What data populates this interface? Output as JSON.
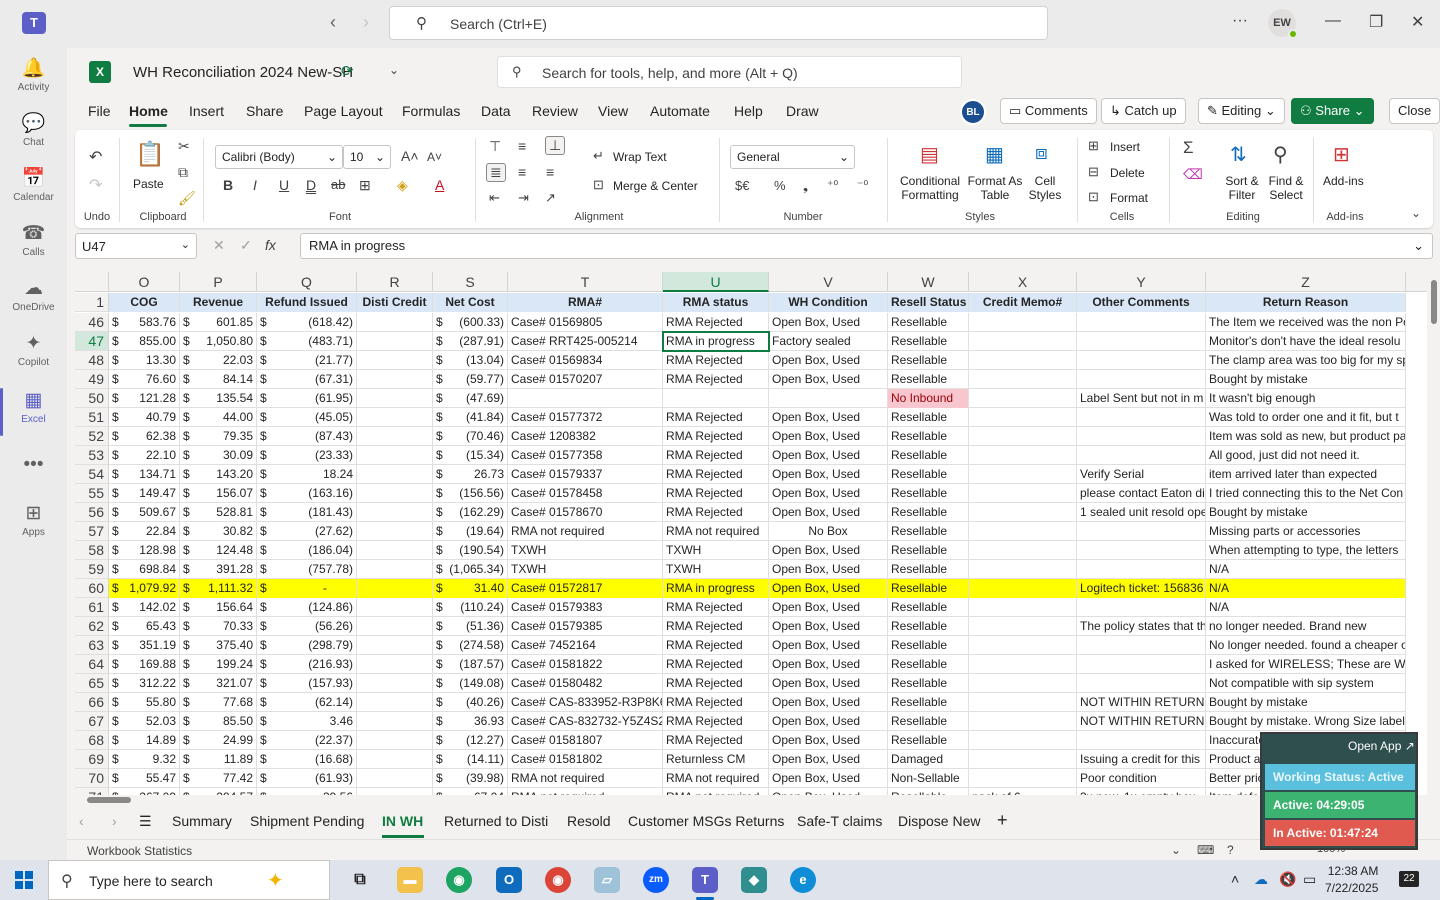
{
  "teams": {
    "search_placeholder": "Search (Ctrl+E)",
    "avatar": "EW",
    "rail": [
      {
        "label": "Activity",
        "icon": "bell-icon",
        "glyph": "🔔"
      },
      {
        "label": "Chat",
        "icon": "chat-icon",
        "glyph": "💬"
      },
      {
        "label": "Calendar",
        "icon": "calendar-icon",
        "glyph": "📅"
      },
      {
        "label": "Calls",
        "icon": "phone-icon",
        "glyph": "☎"
      },
      {
        "label": "OneDrive",
        "icon": "cloud-icon",
        "glyph": "☁"
      },
      {
        "label": "Copilot",
        "icon": "copilot-icon",
        "glyph": "✦"
      },
      {
        "label": "Excel",
        "icon": "excel-icon",
        "glyph": "▦"
      },
      {
        "label": "",
        "icon": "more-icon",
        "glyph": "•••"
      },
      {
        "label": "Apps",
        "icon": "apps-icon",
        "glyph": "⊞"
      }
    ]
  },
  "excel": {
    "title": "WH Reconciliation 2024 New-SH",
    "search_placeholder": "Search for tools, help, and more (Alt + Q)",
    "menus": [
      "File",
      "Home",
      "Insert",
      "Share",
      "Page Layout",
      "Formulas",
      "Data",
      "Review",
      "View",
      "Automate",
      "Help",
      "Draw"
    ],
    "user_badge": "BL",
    "buttons": {
      "comments": "Comments",
      "catchup": "Catch up",
      "editing": "Editing",
      "share": "Share",
      "close": "Close"
    },
    "ribbon": {
      "undo": "Undo",
      "paste": "Paste",
      "clipboard": "Clipboard",
      "font_name": "Calibri (Body)",
      "font_size": "10",
      "font": "Font",
      "wrap_text": "Wrap Text",
      "merge_center": "Merge & Center",
      "alignment": "Alignment",
      "number_format": "General",
      "number": "Number",
      "conditional_1": "Conditional",
      "conditional_2": "Formatting",
      "format_table_1": "Format As",
      "format_table_2": "Table",
      "cell_styles_1": "Cell",
      "cell_styles_2": "Styles",
      "styles": "Styles",
      "insert": "Insert",
      "delete": "Delete",
      "format": "Format",
      "cells": "Cells",
      "sort_filter_1": "Sort &",
      "sort_filter_2": "Filter",
      "find_select_1": "Find &",
      "find_select_2": "Select",
      "editing": "Editing",
      "addins_1": "Add-ins",
      "addins_2": "Add-ins"
    },
    "name_box": "U47",
    "formula": "RMA in progress",
    "columns": [
      "O",
      "P",
      "Q",
      "R",
      "S",
      "T",
      "U",
      "V",
      "W",
      "X",
      "Y",
      "Z"
    ],
    "header_row": {
      "num": "1",
      "cells": [
        "COG",
        "Revenue",
        "Refund Issued",
        "Disti Credit",
        "Net Cost",
        "RMA#",
        "RMA status",
        "WH Condition",
        "Resell Status",
        "Credit Memo#",
        "Other Comments",
        "Return Reason"
      ]
    },
    "rows": [
      {
        "n": "46",
        "o": "583.76",
        "p": "601.85",
        "q": "(618.42)",
        "s": "(600.33)",
        "t": "Case# 01569805",
        "u": "RMA Rejected",
        "v": "Open Box, Used",
        "w": "Resellable",
        "x": "",
        "y": "",
        "z": "The Item we received was the non Po"
      },
      {
        "n": "47",
        "o": "855.00",
        "p": "1,050.80",
        "q": "(483.71)",
        "s": "(287.91)",
        "t": "Case# RRT425-005214",
        "u": "RMA in progress",
        "v": "Factory sealed",
        "w": "Resellable",
        "x": "",
        "y": "",
        "z": "Monitor's don't have the ideal resolu"
      },
      {
        "n": "48",
        "o": "13.30",
        "p": "22.03",
        "q": "(21.77)",
        "s": "(13.04)",
        "t": "Case# 01569834",
        "u": "RMA Rejected",
        "v": "Open Box, Used",
        "w": "Resellable",
        "x": "",
        "y": "",
        "z": "The clamp area was too big for my sp"
      },
      {
        "n": "49",
        "o": "76.60",
        "p": "84.14",
        "q": "(67.31)",
        "s": "(59.77)",
        "t": "Case# 01570207",
        "u": "RMA Rejected",
        "v": "Open Box, Used",
        "w": "Resellable",
        "x": "",
        "y": "",
        "z": "Bought by mistake"
      },
      {
        "n": "50",
        "o": "121.28",
        "p": "135.54",
        "q": "(61.95)",
        "s": "(47.69)",
        "t": "",
        "u": "",
        "v": "",
        "w": "No Inbound",
        "x": "",
        "y": "Label Sent but not in m",
        "z": "It wasn't big enough",
        "pink": true
      },
      {
        "n": "51",
        "o": "40.79",
        "p": "44.00",
        "q": "(45.05)",
        "s": "(41.84)",
        "t": "Case# 01577372",
        "u": "RMA Rejected",
        "v": "Open Box, Used",
        "w": "Resellable",
        "x": "",
        "y": "",
        "z": "Was told to order one and it fit, but t"
      },
      {
        "n": "52",
        "o": "62.38",
        "p": "79.35",
        "q": "(87.43)",
        "s": "(70.46)",
        "t": "Case# 1208382",
        "u": "RMA Rejected",
        "v": "Open Box, Used",
        "w": "Resellable",
        "x": "",
        "y": "",
        "z": "Item was sold as new, but product pa"
      },
      {
        "n": "53",
        "o": "22.10",
        "p": "30.09",
        "q": "(23.33)",
        "s": "(15.34)",
        "t": "Case# 01577358",
        "u": "RMA Rejected",
        "v": "Open Box, Used",
        "w": "Resellable",
        "x": "",
        "y": "",
        "z": "All good, just did not need it."
      },
      {
        "n": "54",
        "o": "134.71",
        "p": "143.20",
        "q": "18.24",
        "s": "26.73",
        "t": "Case# 01579337",
        "u": "RMA Rejected",
        "v": "Open Box, Used",
        "w": "Resellable",
        "x": "",
        "y": "Verify Serial",
        "z": "item arrived later than expected"
      },
      {
        "n": "55",
        "o": "149.47",
        "p": "156.07",
        "q": "(163.16)",
        "s": "(156.56)",
        "t": "Case# 01578458",
        "u": "RMA Rejected",
        "v": "Open Box, Used",
        "w": "Resellable",
        "x": "",
        "y": "please contact Eaton di",
        "z": "I tried connecting this to the Net Con"
      },
      {
        "n": "56",
        "o": "509.67",
        "p": "528.81",
        "q": "(181.43)",
        "s": "(162.29)",
        "t": "Case# 01578670",
        "u": "RMA Rejected",
        "v": "Open Box, Used",
        "w": "Resellable",
        "x": "",
        "y": "1 sealed unit resold ope",
        "z": "Bought by mistake"
      },
      {
        "n": "57",
        "o": "22.84",
        "p": "30.82",
        "q": "(27.62)",
        "s": "(19.64)",
        "t": "RMA not required",
        "u": "RMA not required",
        "v": "No Box",
        "w": "Resellable",
        "x": "",
        "y": "",
        "z": "Missing parts or accessories",
        "vcenter": true
      },
      {
        "n": "58",
        "o": "128.98",
        "p": "124.48",
        "q": "(186.04)",
        "s": "(190.54)",
        "t": "TXWH",
        "u": "TXWH",
        "v": "Open Box, Used",
        "w": "Resellable",
        "x": "",
        "y": "",
        "z": "When attempting to type, the letters"
      },
      {
        "n": "59",
        "o": "698.84",
        "p": "391.28",
        "q": "(757.78)",
        "s": "(1,065.34)",
        "t": "TXWH",
        "u": "TXWH",
        "v": "Open Box, Used",
        "w": "Resellable",
        "x": "",
        "y": "",
        "z": "N/A"
      },
      {
        "n": "60",
        "o": "1,079.92",
        "p": "1,111.32",
        "q": "-",
        "s": "31.40",
        "t": "Case# 01572817",
        "u": "RMA in progress",
        "v": "Open Box, Used",
        "w": "Resellable",
        "x": "",
        "y": "Logitech ticket: 156836",
        "z": "N/A",
        "yellow": true
      },
      {
        "n": "61",
        "o": "142.02",
        "p": "156.64",
        "q": "(124.86)",
        "s": "(110.24)",
        "t": "Case# 01579383",
        "u": "RMA Rejected",
        "v": "Open Box, Used",
        "w": "Resellable",
        "x": "",
        "y": "",
        "z": "N/A"
      },
      {
        "n": "62",
        "o": "65.43",
        "p": "70.33",
        "q": "(56.26)",
        "s": "(51.36)",
        "t": "Case# 01579385",
        "u": "RMA Rejected",
        "v": "Open Box, Used",
        "w": "Resellable",
        "x": "",
        "y": "The policy states that th",
        "z": "no longer needed. Brand new"
      },
      {
        "n": "63",
        "o": "351.19",
        "p": "375.40",
        "q": "(298.79)",
        "s": "(274.58)",
        "t": "Case# 7452164",
        "u": "RMA Rejected",
        "v": "Open Box, Used",
        "w": "Resellable",
        "x": "",
        "y": "",
        "z": "No longer needed. found a cheaper o"
      },
      {
        "n": "64",
        "o": "169.88",
        "p": "199.24",
        "q": "(216.93)",
        "s": "(187.57)",
        "t": "Case# 01581822",
        "u": "RMA Rejected",
        "v": "Open Box, Used",
        "w": "Resellable",
        "x": "",
        "y": "",
        "z": "I asked for WIRELESS; These are WIR"
      },
      {
        "n": "65",
        "o": "312.22",
        "p": "321.07",
        "q": "(157.93)",
        "s": "(149.08)",
        "t": "Case# 01580482",
        "u": "RMA Rejected",
        "v": "Open Box, Used",
        "w": "Resellable",
        "x": "",
        "y": "",
        "z": "Not compatible with sip system"
      },
      {
        "n": "66",
        "o": "55.80",
        "p": "77.68",
        "q": "(62.14)",
        "s": "(40.26)",
        "t": "Case# CAS-833952-R3P8K6-1",
        "u": "RMA Rejected",
        "v": "Open Box, Used",
        "w": "Resellable",
        "x": "",
        "y": "NOT WITHIN RETURN P",
        "z": "Bought by mistake"
      },
      {
        "n": "67",
        "o": "52.03",
        "p": "85.50",
        "q": "3.46",
        "s": "36.93",
        "t": "Case# CAS-832732-Y5Z4S2-1",
        "u": "RMA Rejected",
        "v": "Open Box, Used",
        "w": "Resellable",
        "x": "",
        "y": "NOT WITHIN RETURN P",
        "z": "Bought by mistake. Wrong Size labels"
      },
      {
        "n": "68",
        "o": "14.89",
        "p": "24.99",
        "q": "(22.37)",
        "s": "(12.27)",
        "t": "Case# 01581807",
        "u": "RMA Rejected",
        "v": "Open Box, Used",
        "w": "Resellable",
        "x": "",
        "y": "",
        "z": "Inaccurate website description. item"
      },
      {
        "n": "69",
        "o": "9.32",
        "p": "11.89",
        "q": "(16.68)",
        "s": "(14.11)",
        "t": "Case# 01581802",
        "u": "Returnless CM",
        "v": "Open Box, Used",
        "w": "Damaged",
        "x": "",
        "y": "Issuing a credit for this",
        "z": "Product and shipping box damaged"
      },
      {
        "n": "70",
        "o": "55.47",
        "p": "77.42",
        "q": "(61.93)",
        "s": "(39.98)",
        "t": "RMA not required",
        "u": "RMA not required",
        "v": "Open Box, Used",
        "w": "Non-Sellable",
        "x": "",
        "y": "Poor condition",
        "z": "Better price available"
      },
      {
        "n": "71",
        "o": "267.09",
        "p": "294.57",
        "q": "39.56",
        "s": "67.04",
        "t": "RMA not required",
        "u": "RMA not required",
        "v": "Open Box, Used",
        "w": "Resellable",
        "x": "pack of 6",
        "y": "3x new, 1x empty box",
        "z": "Item defective or doesn't work"
      }
    ],
    "currency": "$",
    "sheets": [
      "Summary",
      "Shipment Pending",
      "IN WH",
      "Returned to Disti",
      "Resold",
      "Customer MSGs Returns",
      "Safe-T claims",
      "Dispose New"
    ],
    "status_text": "Workbook Statistics",
    "zoom": "100%"
  },
  "widget": {
    "open_app": "Open App",
    "status": "Working Status: Active",
    "active": "Active: 04:29:05",
    "inactive": "In Active: 01:47:24"
  },
  "taskbar": {
    "search_placeholder": "Type here to search",
    "time": "12:38 AM",
    "date": "7/22/2025",
    "notifications": "22"
  }
}
